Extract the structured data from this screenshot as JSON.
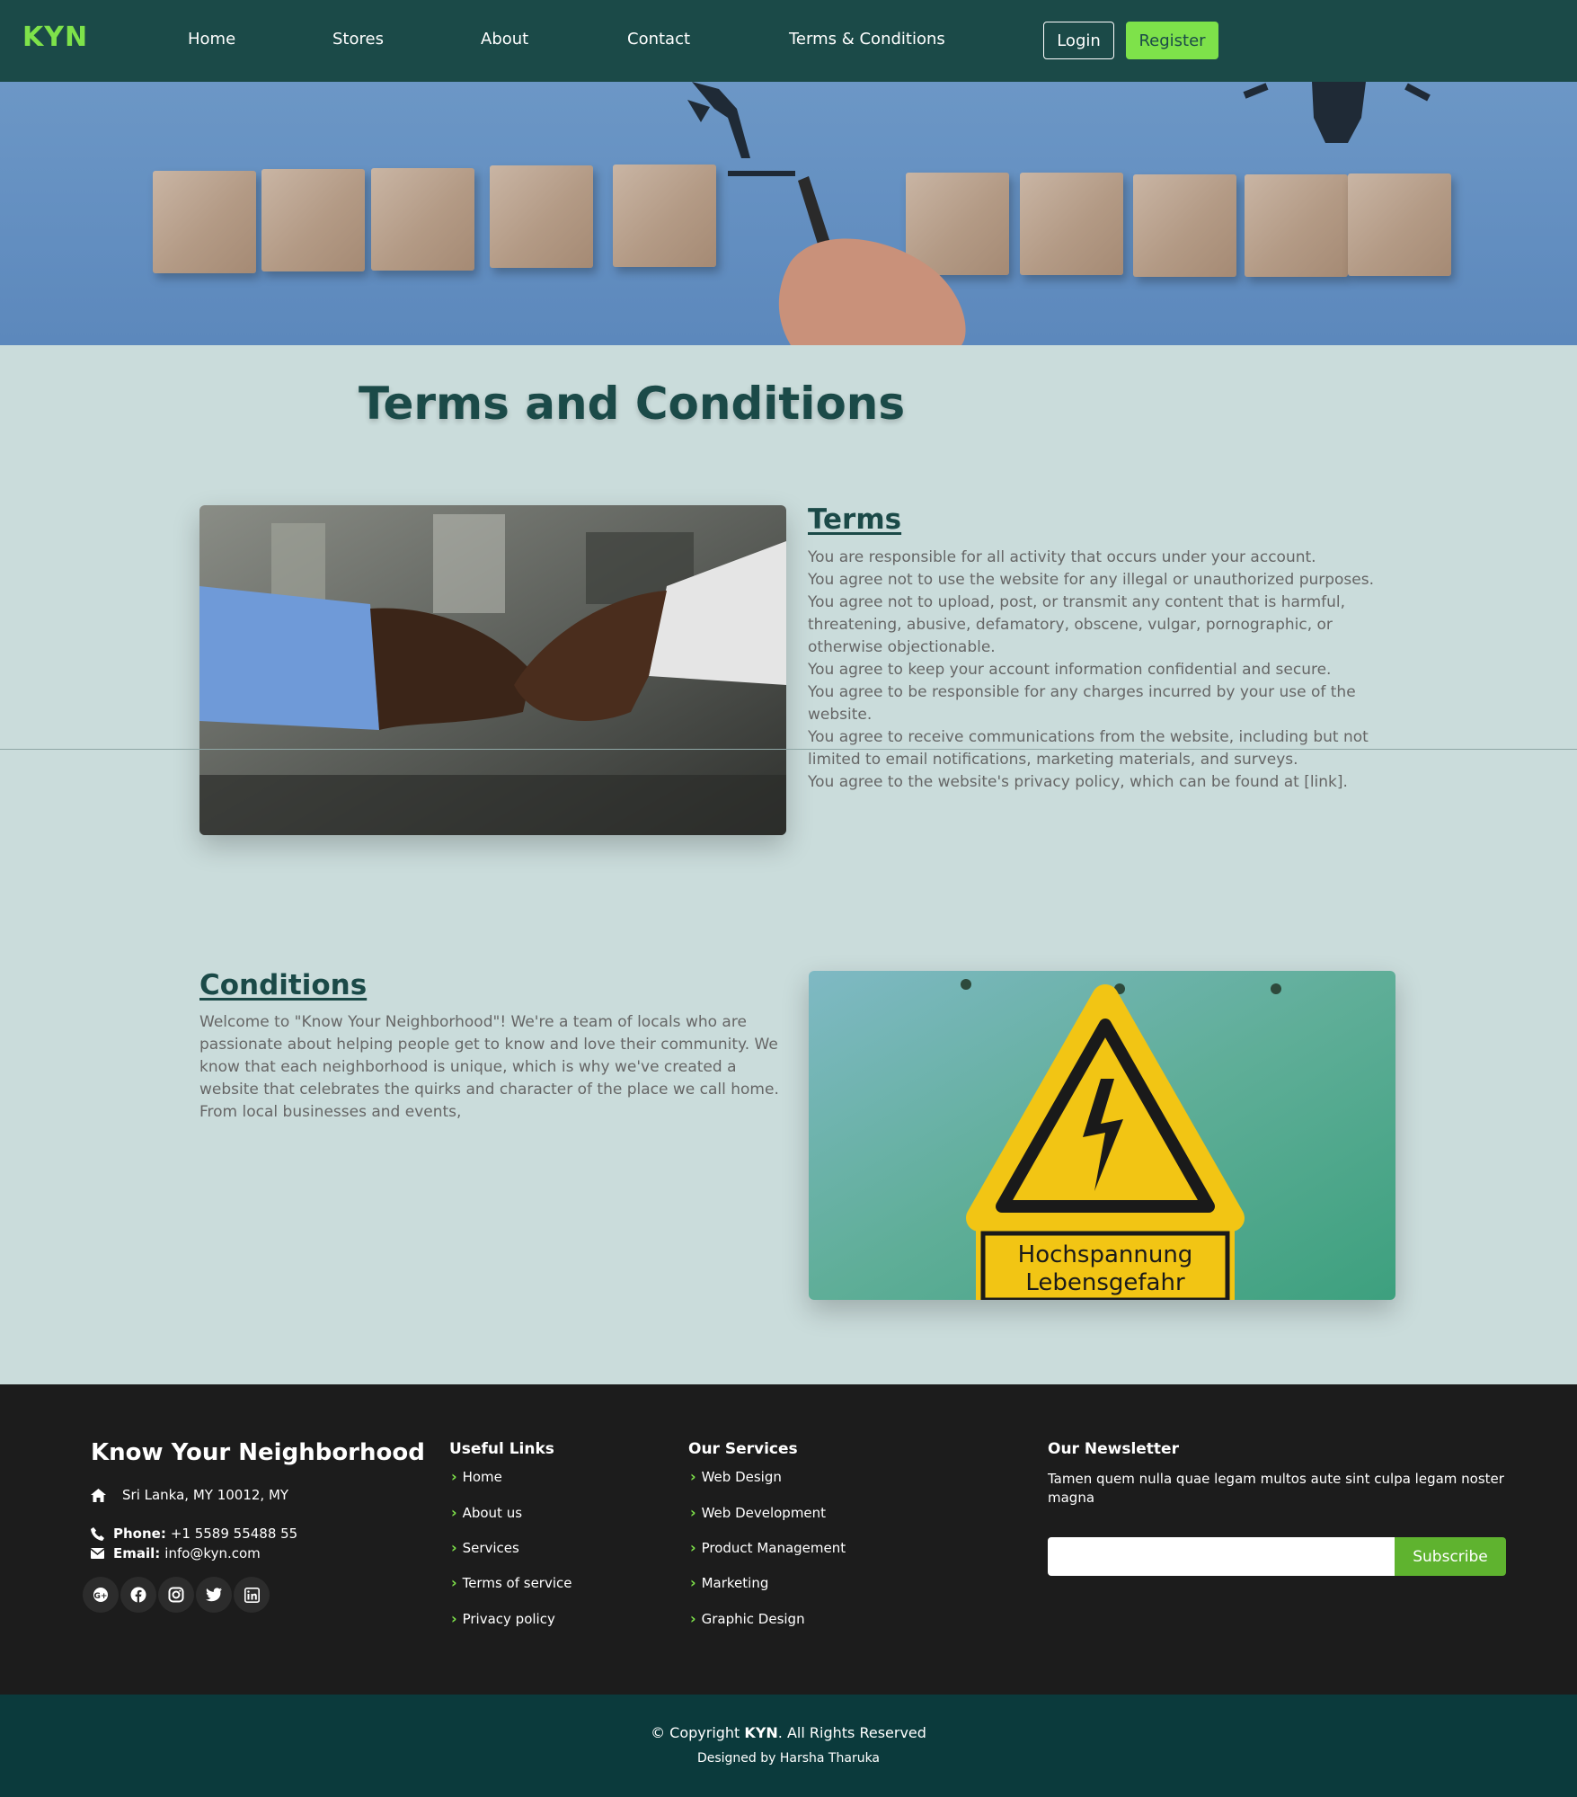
{
  "brand": {
    "logo": "KYN"
  },
  "nav": {
    "links": [
      "Home",
      "Stores",
      "About",
      "Contact",
      "Terms & Conditions"
    ],
    "login": "Login",
    "register": "Register"
  },
  "main": {
    "title": "Terms and Conditions",
    "terms": {
      "heading": "Terms",
      "lines": [
        "You are responsible for all activity that occurs under your account.",
        "You agree not to use the website for any illegal or unauthorized purposes.",
        "You agree not to upload, post, or transmit any content that is harmful, threatening, abusive, defamatory, obscene, vulgar, pornographic, or otherwise objectionable.",
        "You agree to keep your account information confidential and secure.",
        "You agree to be responsible for any charges incurred by your use of the website.",
        "You agree to receive communications from the website, including but not limited to email notifications, marketing materials, and surveys.",
        "You agree to the website's privacy policy, which can be found at [link]."
      ]
    },
    "conditions": {
      "heading": "Conditions",
      "body": "Welcome to \"Know Your Neighborhood\"! We're a team of locals who are passionate about helping people get to know and love their community. We know that each neighborhood is unique, which is why we've created a website that celebrates the quirks and character of the place we call home. From local businesses and events,"
    },
    "sign_text": {
      "line1": "Hochspannung",
      "line2": "Lebensgefahr"
    }
  },
  "footer": {
    "brand": "Know Your Neighborhood",
    "address": "Sri Lanka, MY 10012, MY",
    "phone_label": "Phone:",
    "phone": "+1 5589 55488 55",
    "email_label": "Email:",
    "email": "info@kyn.com",
    "social_icons": [
      "google-plus-icon",
      "facebook-icon",
      "instagram-icon",
      "twitter-icon",
      "linkedin-icon"
    ],
    "useful_links": {
      "title": "Useful Links",
      "items": [
        "Home",
        "About us",
        "Services",
        "Terms of service",
        "Privacy policy"
      ]
    },
    "services": {
      "title": "Our Services",
      "items": [
        "Web Design",
        "Web Development",
        "Product Management",
        "Marketing",
        "Graphic Design"
      ]
    },
    "newsletter": {
      "title": "Our Newsletter",
      "text": "Tamen quem nulla quae legam multos aute sint culpa legam noster magna",
      "input_value": "",
      "button": "Subscribe"
    }
  },
  "copyright": {
    "prefix": "© Copyright",
    "brand": "KYN",
    "suffix": ". All Rights Reserved",
    "designed": "Designed by Harsha Tharuka"
  },
  "colors": {
    "nav_bg": "#1b4a48",
    "accent": "#7ee24a",
    "page_bg": "#cadcdb",
    "footer_bg": "#1c1c1c",
    "copyright_bg": "#0b3a3c"
  }
}
